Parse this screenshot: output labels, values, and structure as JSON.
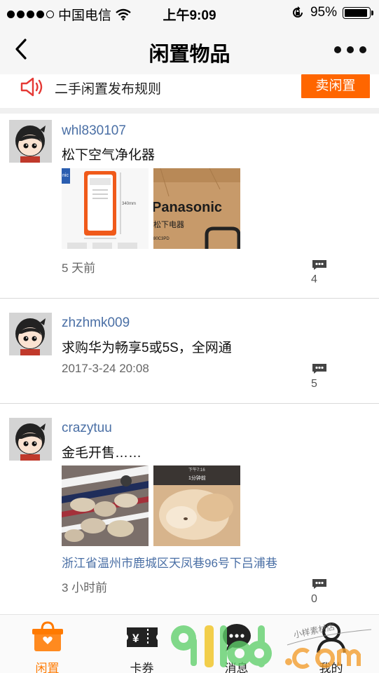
{
  "status_bar": {
    "carrier": "中国电信",
    "time": "上午9:09",
    "battery": "95%",
    "battery_level": 0.95
  },
  "nav": {
    "title": "闲置物品"
  },
  "rules_bar": {
    "text": "二手闲置发布规则",
    "sell_button": "卖闲置"
  },
  "posts": [
    {
      "username": "whl830107",
      "content": "松下空气净化器",
      "images": [
        "panasonic-air-purifier-photo",
        "panasonic-box-photo"
      ],
      "image_texts": [
        "340mm",
        "Panasonic",
        "松下电器",
        "80C3PD"
      ],
      "location": "",
      "time": "5 天前",
      "comments": "4"
    },
    {
      "username": "zhzhmk009",
      "content": "求购华为畅享5或5S，全网通",
      "images": [],
      "location": "",
      "time": "2017-3-24 20:08",
      "comments": "5"
    },
    {
      "username": "crazytuu",
      "content": "金毛开售……",
      "images": [
        "puppies-on-blanket-photo",
        "puppy-sleeping-photo"
      ],
      "image_texts": [
        "下午7:16",
        "1分钟前"
      ],
      "location": "浙江省温州市鹿城区天凤巷96号下吕浦巷",
      "time": "3 小时前",
      "comments": "0"
    }
  ],
  "tabs": [
    {
      "label": "闲置",
      "icon": "shopping-bag-icon",
      "active": true
    },
    {
      "label": "卡券",
      "icon": "voucher-icon",
      "active": false
    },
    {
      "label": "消息",
      "icon": "chat-icon",
      "active": false
    },
    {
      "label": "我的",
      "icon": "person-icon",
      "active": false
    }
  ],
  "watermark": {
    "logo": "91bd.com",
    "script": "小样素材店"
  },
  "colors": {
    "accent": "#ff6600",
    "link": "#4a6fa5",
    "active_tab": "#ff7a00"
  }
}
